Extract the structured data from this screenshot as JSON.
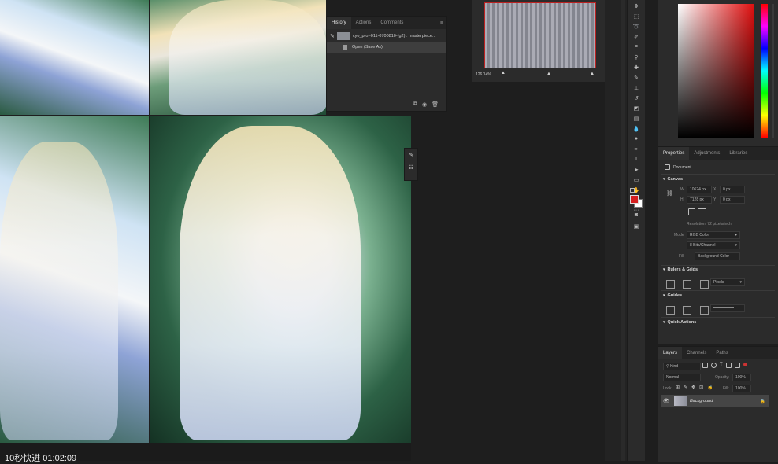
{
  "history_panel": {
    "tabs": [
      "History",
      "Actions",
      "Comments"
    ],
    "snapshot_label": "cyo_prof-011-0700810-(g2) : masterpiece...",
    "step_label": "Open (Save As)"
  },
  "navigator": {
    "zoom": "126.14%"
  },
  "properties_panel": {
    "tabs": [
      "Properties",
      "Adjustments",
      "Libraries"
    ],
    "doc_type": "Document",
    "canvas_section": "Canvas",
    "width_label": "W",
    "width_value": "10624 px",
    "height_label": "H",
    "height_value": "7128 px",
    "x_label": "X",
    "x_value": "0 px",
    "y_label": "Y",
    "y_value": "0 px",
    "resolution": "Resolution: 72 pixels/inch",
    "mode_label": "Mode",
    "mode_value": "RGB Color",
    "depth_value": "8 Bits/Channel",
    "fill_label": "Fill",
    "fill_value": "Background Color",
    "rulers_section": "Rulers & Grids",
    "units_value": "Pixels",
    "guides_section": "Guides",
    "quick_actions_section": "Quick Actions"
  },
  "layers_panel": {
    "tabs": [
      "Layers",
      "Channels",
      "Paths"
    ],
    "search_placeholder": "Kind",
    "blend_mode": "Normal",
    "opacity_label": "Opacity:",
    "opacity_value": "100%",
    "lock_label": "Lock:",
    "fill_label": "Fill:",
    "fill_value": "100%",
    "layer_name": "Background"
  },
  "colors": {
    "foreground": "#d42020",
    "background": "#ffffff"
  },
  "subtitle": "10秒快进  01:02:09"
}
